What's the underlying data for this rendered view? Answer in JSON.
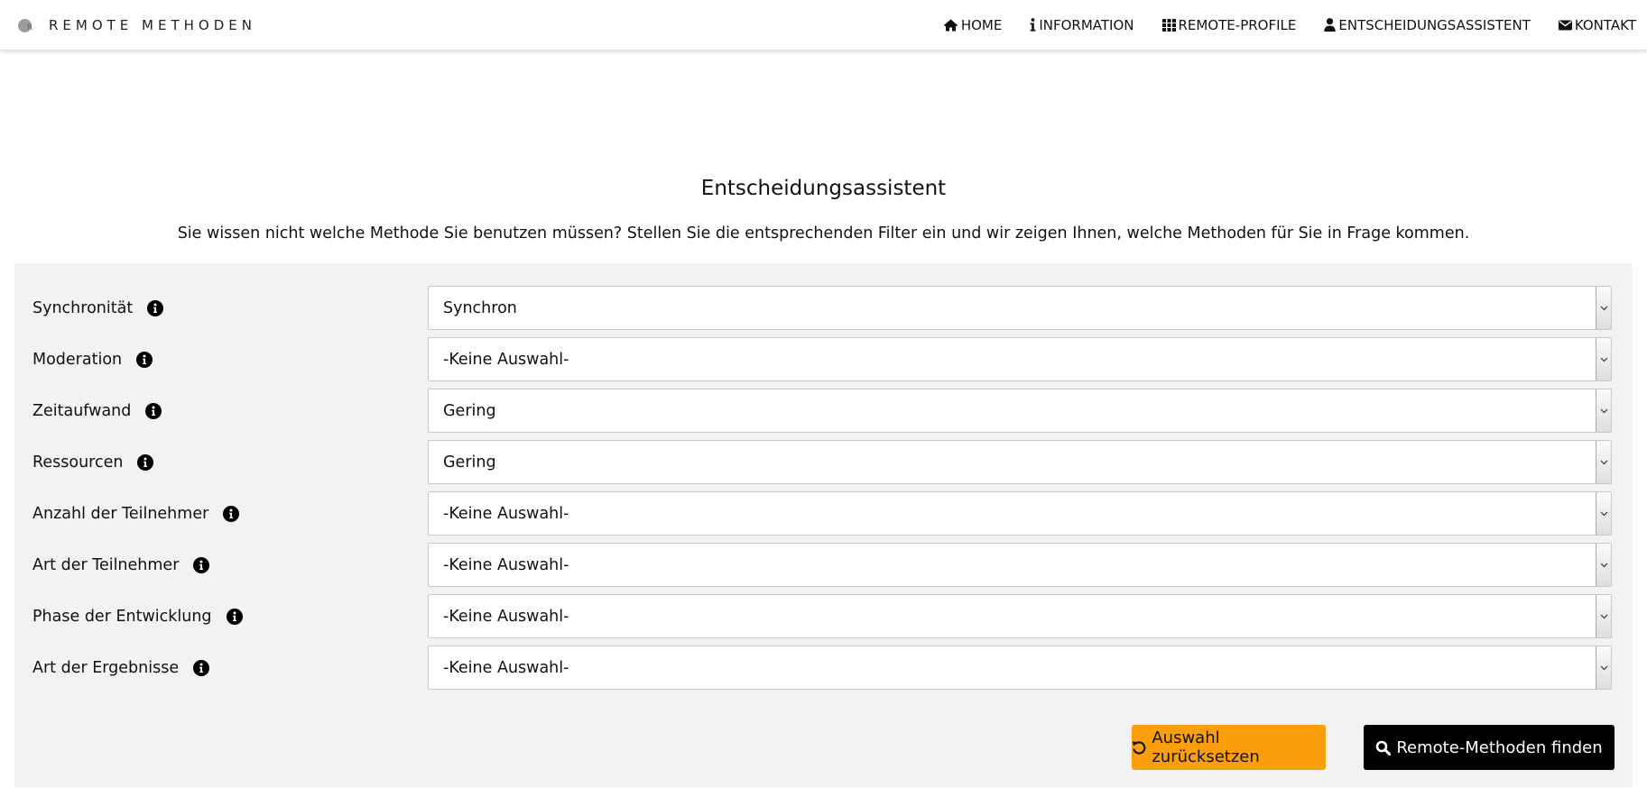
{
  "brand": {
    "name": "REMOTE METHODEN",
    "logo_mark": "R"
  },
  "nav": [
    {
      "label": "HOME",
      "icon": "home-icon"
    },
    {
      "label": "INFORMATION",
      "icon": "info-icon"
    },
    {
      "label": "REMOTE-PROFILE",
      "icon": "grid-icon"
    },
    {
      "label": "ENTSCHEIDUNGSASSISTENT",
      "icon": "user-icon"
    },
    {
      "label": "KONTAKT",
      "icon": "envelope-icon"
    }
  ],
  "main": {
    "title": "Entscheidungsassistent",
    "lead": "Sie wissen nicht welche Methode Sie benutzen müssen? Stellen Sie die entsprechenden Filter ein und wir zeigen Ihnen, welche Methoden für Sie in Frage kommen."
  },
  "filters": [
    {
      "label": "Synchronität",
      "value": "Synchron"
    },
    {
      "label": "Moderation",
      "value": "-Keine Auswahl-"
    },
    {
      "label": "Zeitaufwand",
      "value": "Gering"
    },
    {
      "label": "Ressourcen",
      "value": "Gering"
    },
    {
      "label": "Anzahl der Teilnehmer",
      "value": "-Keine Auswahl-"
    },
    {
      "label": "Art der Teilnehmer",
      "value": "-Keine Auswahl-"
    },
    {
      "label": "Phase der Entwicklung",
      "value": "-Keine Auswahl-"
    },
    {
      "label": "Art der Ergebnisse",
      "value": "-Keine Auswahl-"
    }
  ],
  "buttons": {
    "reset_label": "Auswahl zurücksetzen",
    "find_label": "Remote-Methoden finden"
  },
  "colors": {
    "accent_orange": "#fa9e0c",
    "primary_black": "#000000",
    "panel_background": "#f2f2f2"
  }
}
